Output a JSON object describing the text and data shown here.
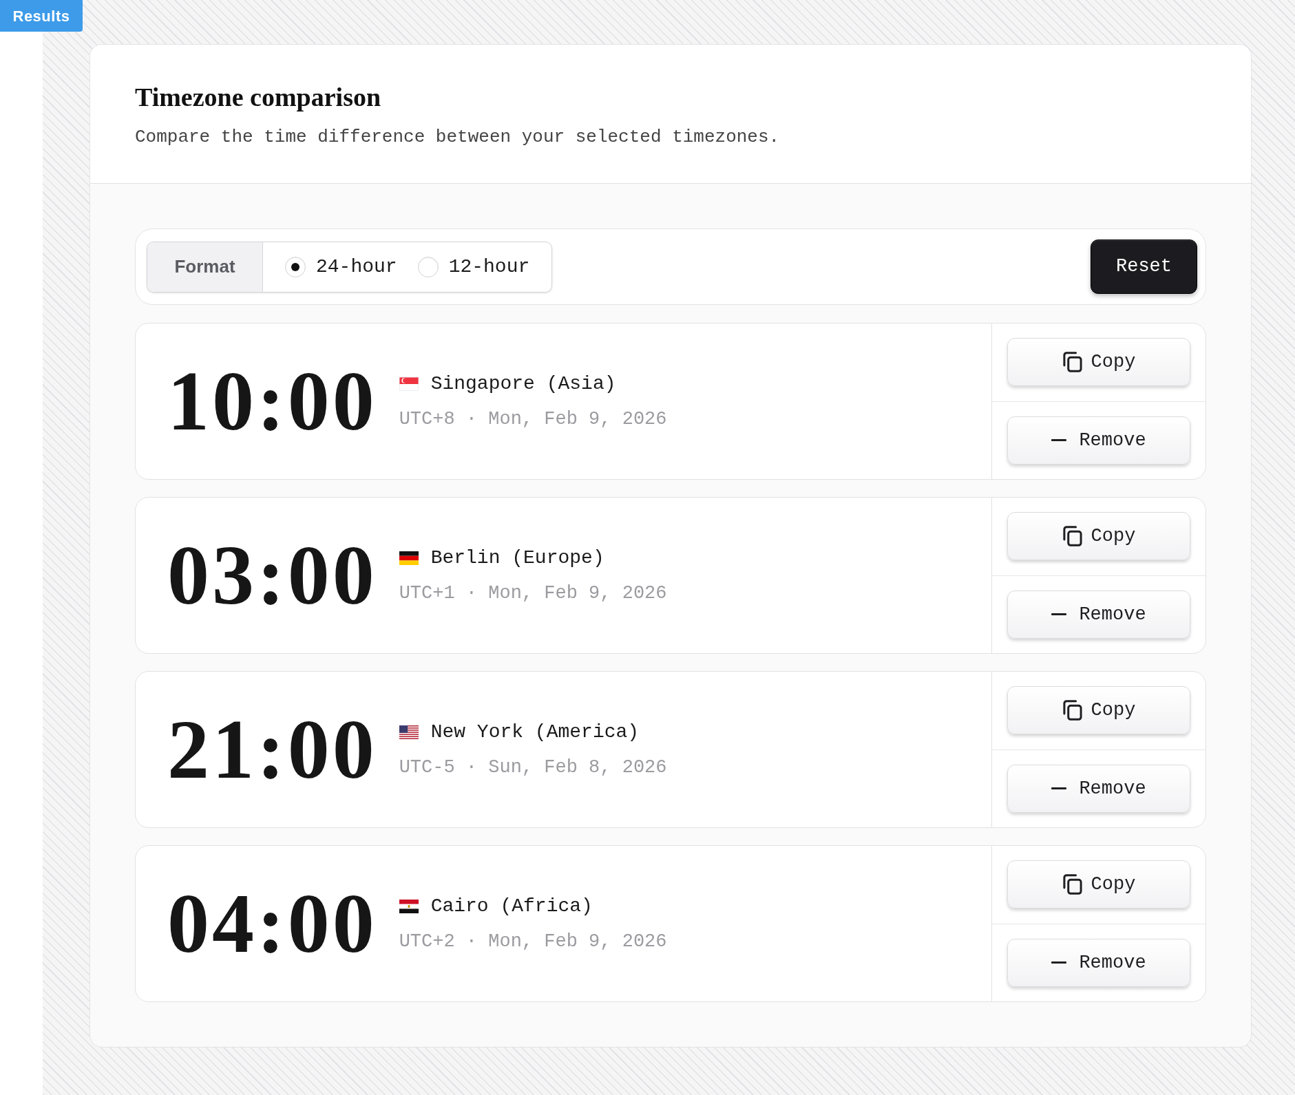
{
  "badge": {
    "label": "Results"
  },
  "header": {
    "title": "Timezone comparison",
    "subtitle": "Compare the time difference between your selected timezones."
  },
  "toolbar": {
    "label": "Format",
    "options": [
      {
        "label": "24-hour",
        "selected": true
      },
      {
        "label": "12-hour",
        "selected": false
      }
    ],
    "reset_button": "Reset"
  },
  "timezones": [
    {
      "time": "10:00",
      "kind": "sg",
      "city": "Singapore (Asia)",
      "details": "UTC+8 · Mon, Feb 9, 2026",
      "copy_button": "Copy",
      "remove_button": "Remove"
    },
    {
      "time": "03:00",
      "kind": "de",
      "city": "Berlin (Europe)",
      "details": "UTC+1 · Mon, Feb 9, 2026",
      "copy_button": "Copy",
      "remove_button": "Remove"
    },
    {
      "time": "21:00",
      "kind": "us",
      "city": "New York (America)",
      "details": "UTC-5 · Sun, Feb 8, 2026",
      "copy_button": "Copy",
      "remove_button": "Remove"
    },
    {
      "time": "04:00",
      "kind": "eg",
      "city": "Cairo (Africa)",
      "details": "UTC+2 · Mon, Feb 9, 2026",
      "copy_button": "Copy",
      "remove_button": "Remove"
    }
  ]
}
